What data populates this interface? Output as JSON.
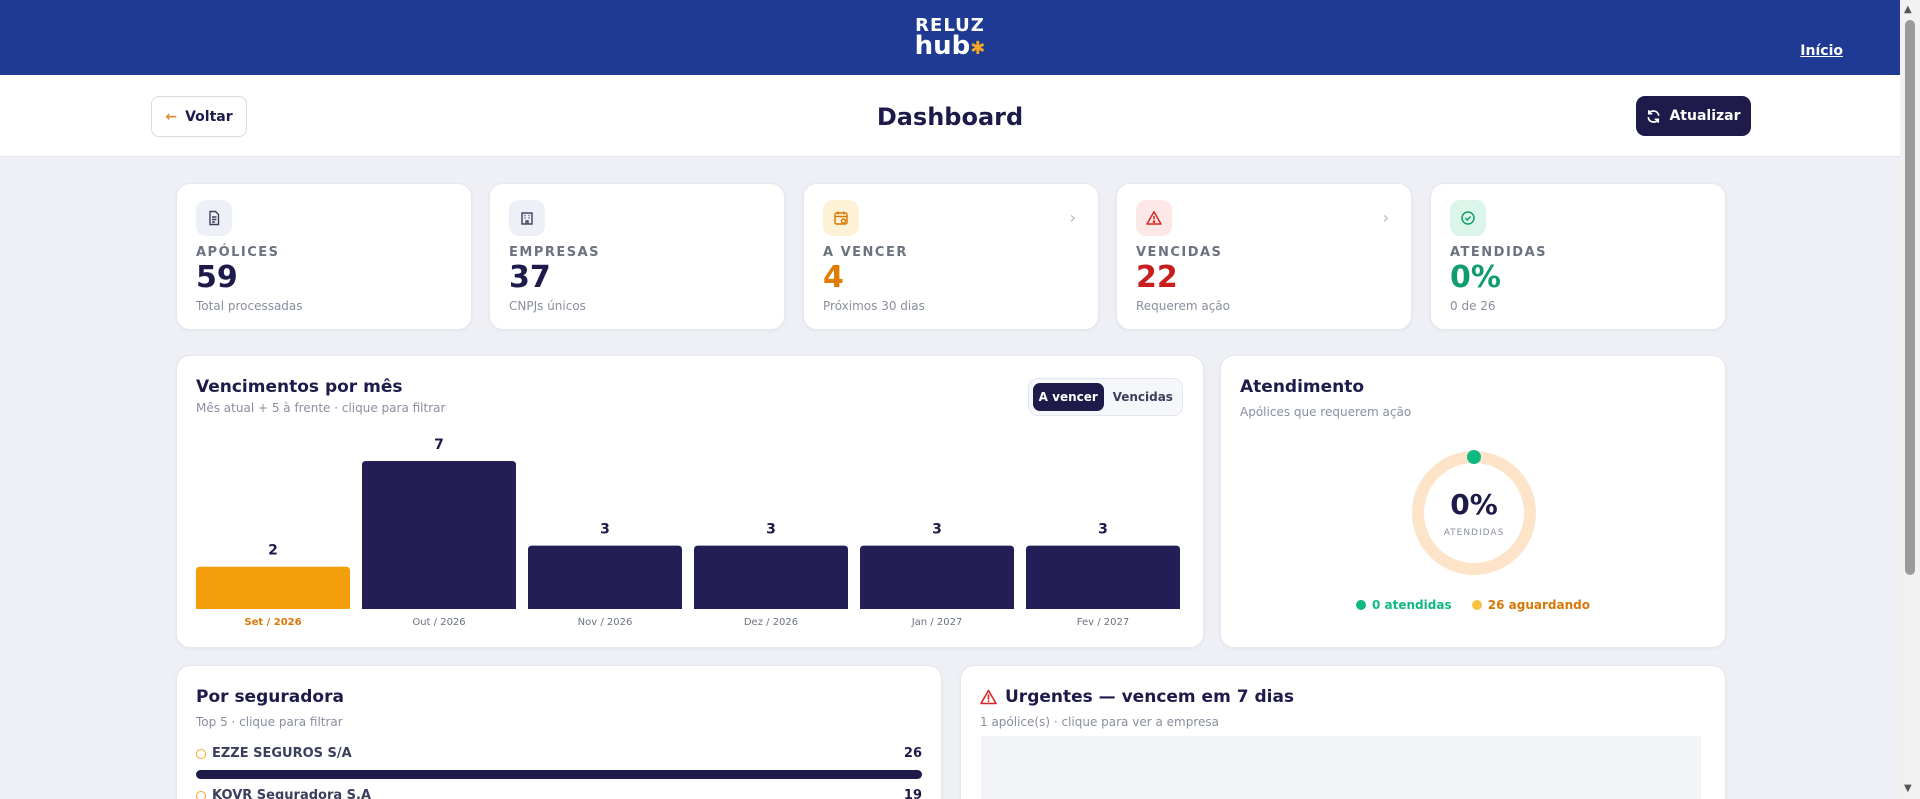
{
  "header": {
    "logo_line1": "RELUZ",
    "logo_line2": "hub",
    "nav_home": "Início"
  },
  "subheader": {
    "back_label": "Voltar",
    "title": "Dashboard",
    "refresh_label": "Atualizar"
  },
  "stats": [
    {
      "label": "APÓLICES",
      "value": "59",
      "sub": "Total processadas",
      "color": "#1e1b4b",
      "icon": "document-icon",
      "icon_bg": "#eef0f7"
    },
    {
      "label": "EMPRESAS",
      "value": "37",
      "sub": "CNPJs únicos",
      "color": "#1e1b4b",
      "icon": "building-icon",
      "icon_bg": "#eef0f7"
    },
    {
      "label": "A VENCER",
      "value": "4",
      "sub": "Próximos 30 dias",
      "color": "#e07b00",
      "icon": "calendar-clock-icon",
      "icon_bg": "#fdf1d6"
    },
    {
      "label": "VENCIDAS",
      "value": "22",
      "sub": "Requerem ação",
      "color": "#c81e1e",
      "icon": "warning-icon",
      "icon_bg": "#fde7e7"
    },
    {
      "label": "ATENDIDAS",
      "value": "0%",
      "sub": "0 de 26",
      "color": "#0f9d6b",
      "icon": "check-circle-icon",
      "icon_bg": "#dcf5ea"
    }
  ],
  "vencimentos": {
    "title": "Vencimentos por mês",
    "subtitle": "Mês atual + 5 à frente · clique para filtrar",
    "toggle": {
      "a_vencer": "A vencer",
      "vencidas": "Vencidas",
      "active": "a_vencer"
    }
  },
  "chart_data": {
    "type": "bar",
    "categories": [
      "Set / 2026",
      "Out / 2026",
      "Nov / 2026",
      "Dez / 2026",
      "Jan / 2027",
      "Fev / 2027"
    ],
    "values": [
      2,
      7,
      3,
      3,
      3,
      3
    ],
    "highlight_index": 0,
    "colors": {
      "highlight": "#f59e0b",
      "default": "#231f56",
      "highlight_label": "#d97706",
      "label": "#6b7280"
    },
    "ylim": [
      0,
      7
    ]
  },
  "atendimento": {
    "title": "Atendimento",
    "subtitle": "Apólices que requerem ação",
    "percent": "0%",
    "percent_label": "ATENDIDAS",
    "legend_done": "0 atendidas",
    "legend_waiting": "26 aguardando",
    "colors": {
      "done": "#10b981",
      "waiting": "#f5c242",
      "ring": "#fde4c8"
    }
  },
  "seguradora": {
    "title": "Por seguradora",
    "subtitle": "Top 5 · clique para filtrar",
    "items": [
      {
        "name": "EZZE SEGUROS S/A",
        "count": "26"
      },
      {
        "name": "KOVR Seguradora S.A",
        "count": "19"
      }
    ]
  },
  "urgentes": {
    "title": "Urgentes — vencem em 7 dias",
    "subtitle": "1 apólice(s) · clique para ver a empresa"
  }
}
